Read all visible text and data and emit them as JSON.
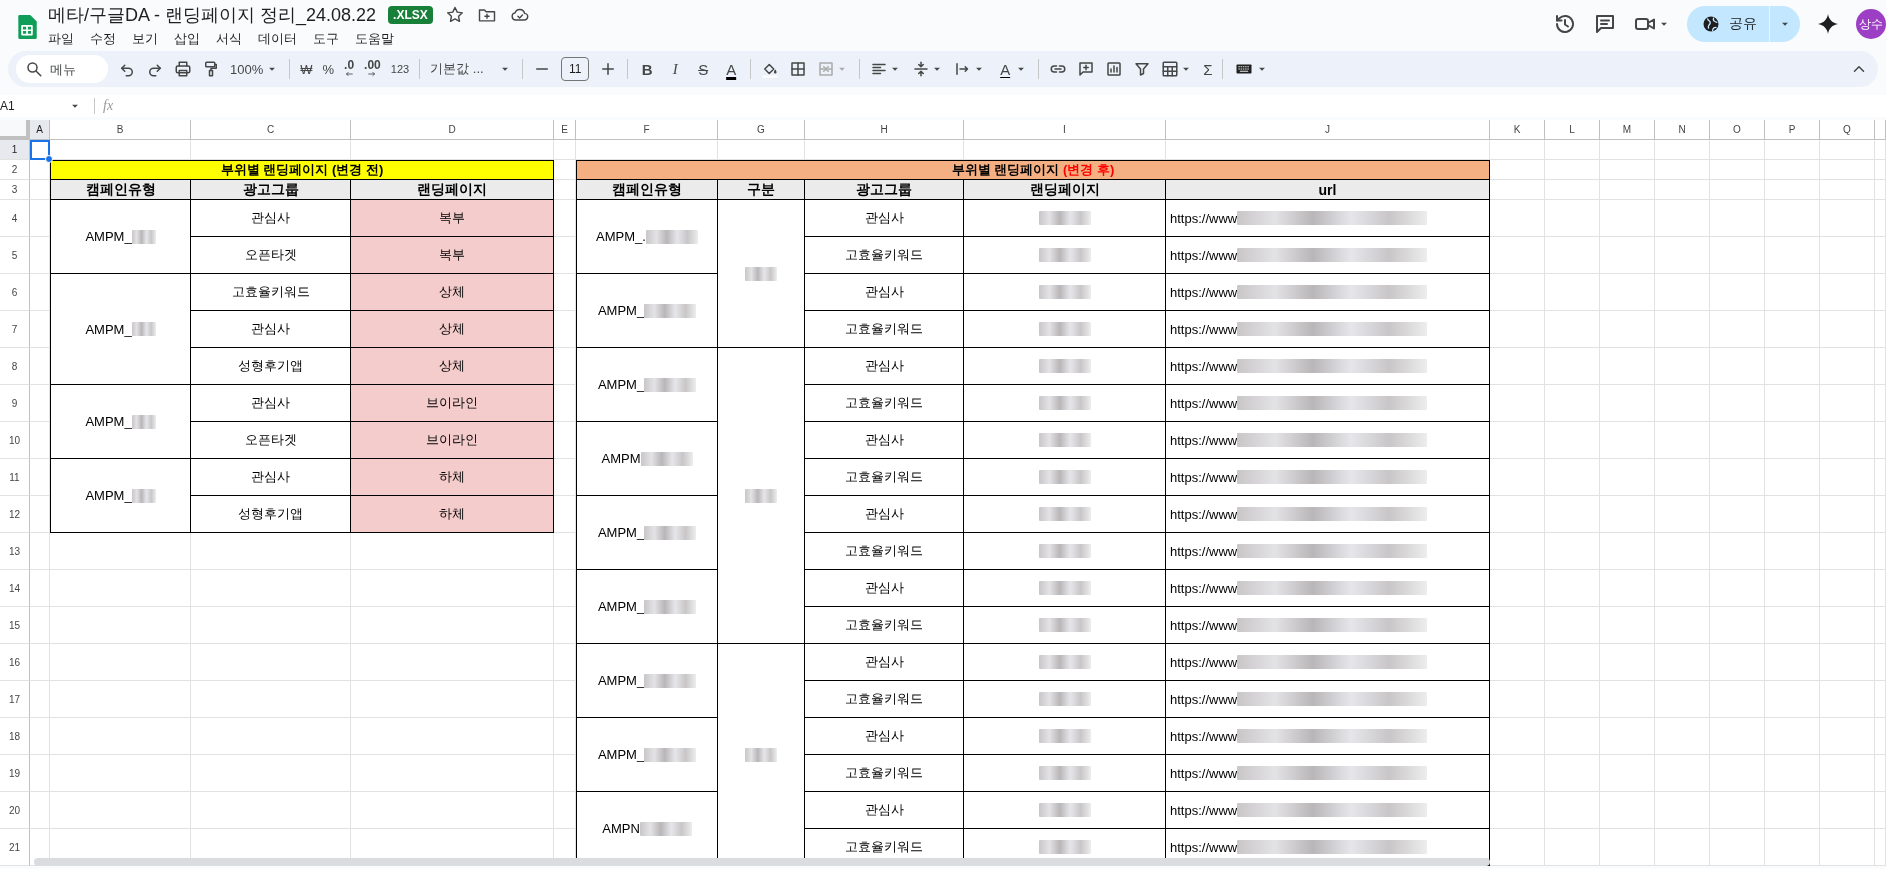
{
  "document": {
    "title": "메타/구글DA - 랜딩페이지 정리_24.08.22",
    "badge": ".XLSX"
  },
  "menu": [
    "파일",
    "수정",
    "보기",
    "삽입",
    "서식",
    "데이터",
    "도구",
    "도움말"
  ],
  "share_button": "공유",
  "avatar": "상수",
  "toolbar": {
    "search": {
      "placeholder": "메뉴"
    },
    "zoom": "100%",
    "currency": "₩",
    "percent": "%",
    "decrease_decimal": ".0",
    "increase_decimal": ".00",
    "number_format": "123",
    "font": "기본값 ...",
    "font_size": "11",
    "text_styles": [
      {
        "kind": "bold",
        "label": "B"
      },
      {
        "kind": "italic",
        "label": "I"
      },
      {
        "kind": "strike",
        "label": "S"
      },
      {
        "kind": "color",
        "label": "A"
      }
    ],
    "rotate_label": "A",
    "functions": "Σ"
  },
  "formula_bar": {
    "name_box": "A1",
    "fx": "fx"
  },
  "columns": [
    {
      "label": "A",
      "selected": true
    },
    {
      "label": "B",
      "selected": false
    },
    {
      "label": "C",
      "selected": false
    },
    {
      "label": "D",
      "selected": false
    },
    {
      "label": "E",
      "selected": false
    },
    {
      "label": "F",
      "selected": false
    },
    {
      "label": "G",
      "selected": false
    },
    {
      "label": "H",
      "selected": false
    },
    {
      "label": "I",
      "selected": false
    },
    {
      "label": "J",
      "selected": false
    },
    {
      "label": "K",
      "selected": false
    },
    {
      "label": "L",
      "selected": false
    },
    {
      "label": "M",
      "selected": false
    },
    {
      "label": "N",
      "selected": false
    },
    {
      "label": "O",
      "selected": false
    },
    {
      "label": "P",
      "selected": false
    },
    {
      "label": "Q",
      "selected": false
    }
  ],
  "rows": [
    {
      "label": "1",
      "selected": true
    },
    {
      "label": "2",
      "selected": false
    },
    {
      "label": "3",
      "selected": false
    },
    {
      "label": "4",
      "selected": false
    },
    {
      "label": "5",
      "selected": false
    },
    {
      "label": "6",
      "selected": false
    },
    {
      "label": "7",
      "selected": false
    },
    {
      "label": "8",
      "selected": false
    },
    {
      "label": "9",
      "selected": false
    },
    {
      "label": "10",
      "selected": false
    },
    {
      "label": "11",
      "selected": false
    },
    {
      "label": "12",
      "selected": false
    },
    {
      "label": "13",
      "selected": false
    },
    {
      "label": "14",
      "selected": false
    },
    {
      "label": "15",
      "selected": false
    },
    {
      "label": "16",
      "selected": false
    },
    {
      "label": "17",
      "selected": false
    },
    {
      "label": "18",
      "selected": false
    },
    {
      "label": "19",
      "selected": false
    },
    {
      "label": "20",
      "selected": false
    },
    {
      "label": "21",
      "selected": false
    }
  ],
  "table_before": {
    "title": "부위별 랜딩페이지 (변경 전)",
    "headers": [
      "캠페인유형",
      "광고그룹",
      "랜딩페이지"
    ],
    "groups": [
      {
        "campaign": "AMPM_",
        "rows": [
          {
            "ad_group": "관심사",
            "landing": "복부"
          },
          {
            "ad_group": "오픈타겟",
            "landing": "복부"
          }
        ]
      },
      {
        "campaign": "AMPM_",
        "rows": [
          {
            "ad_group": "고효율키워드",
            "landing": "상체"
          },
          {
            "ad_group": "관심사",
            "landing": "상체"
          },
          {
            "ad_group": "성형후기앱",
            "landing": "상체"
          }
        ]
      },
      {
        "campaign": "AMPM_",
        "rows": [
          {
            "ad_group": "관심사",
            "landing": "브이라인"
          },
          {
            "ad_group": "오픈타겟",
            "landing": "브이라인"
          }
        ]
      },
      {
        "campaign": "AMPM_",
        "rows": [
          {
            "ad_group": "관심사",
            "landing": "하체"
          },
          {
            "ad_group": "성형후기앱",
            "landing": "하체"
          }
        ]
      }
    ]
  },
  "table_after": {
    "title": "부위별 랜딩페이지",
    "title_highlight": "(변경 후)",
    "headers": [
      "캠페인유형",
      "구분",
      "광고그룹",
      "랜딩페이지",
      "url"
    ],
    "sections": [
      {
        "campaigns": [
          {
            "campaign": "AMPM_.",
            "rows": [
              {
                "ad_group": "관심사",
                "url": "https://www"
              },
              {
                "ad_group": "고효율키워드",
                "url": "https://www"
              }
            ]
          },
          {
            "campaign": "AMPM_",
            "rows": [
              {
                "ad_group": "관심사",
                "url": "https://www"
              },
              {
                "ad_group": "고효율키워드",
                "url": "https://www"
              }
            ]
          }
        ]
      },
      {
        "campaigns": [
          {
            "campaign": "AMPM_",
            "rows": [
              {
                "ad_group": "관심사",
                "url": "https://www"
              },
              {
                "ad_group": "고효율키워드",
                "url": "https://www"
              }
            ]
          },
          {
            "campaign": "AMPM",
            "rows": [
              {
                "ad_group": "관심사",
                "url": "https://www"
              },
              {
                "ad_group": "고효율키워드",
                "url": "https://www"
              }
            ]
          },
          {
            "campaign": "AMPM_",
            "rows": [
              {
                "ad_group": "관심사",
                "url": "https://www"
              },
              {
                "ad_group": "고효율키워드",
                "url": "https://www"
              }
            ]
          },
          {
            "campaign": "AMPM_",
            "rows": [
              {
                "ad_group": "관심사",
                "url": "https://www"
              },
              {
                "ad_group": "고효율키워드",
                "url": "https://www"
              }
            ]
          }
        ]
      },
      {
        "campaigns": [
          {
            "campaign": "AMPM_",
            "rows": [
              {
                "ad_group": "관심사",
                "url": "https://www"
              },
              {
                "ad_group": "고효율키워드",
                "url": "https://www"
              }
            ]
          },
          {
            "campaign": "AMPM_",
            "rows": [
              {
                "ad_group": "관심사",
                "url": "https://www"
              },
              {
                "ad_group": "고효율키워드",
                "url": "https://www"
              }
            ]
          },
          {
            "campaign": "AMPN",
            "rows": [
              {
                "ad_group": "관심사",
                "url": "https://www"
              },
              {
                "ad_group": "고효율키워드",
                "url": "https://www"
              }
            ]
          }
        ]
      }
    ]
  }
}
